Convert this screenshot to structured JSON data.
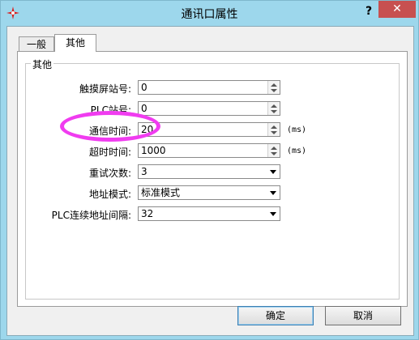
{
  "window": {
    "title": "通讯口属性",
    "help_label": "?",
    "close_label": "✕"
  },
  "tabs": [
    {
      "label": "一般",
      "active": false
    },
    {
      "label": "其他",
      "active": true
    }
  ],
  "group": {
    "title": "其他"
  },
  "fields": [
    {
      "label": "触摸屏站号:",
      "value": "0",
      "control": "spinner",
      "unit": ""
    },
    {
      "label": "PLC站号:",
      "value": "0",
      "control": "spinner",
      "unit": ""
    },
    {
      "label": "通信时间:",
      "value": "20",
      "control": "spinner",
      "unit": "(ms)"
    },
    {
      "label": "超时时间:",
      "value": "1000",
      "control": "spinner",
      "unit": "(ms)"
    },
    {
      "label": "重试次数:",
      "value": "3",
      "control": "dropdown",
      "unit": ""
    },
    {
      "label": "地址模式:",
      "value": "标准模式",
      "control": "dropdown",
      "unit": ""
    },
    {
      "label": "PLC连续地址间隔:",
      "value": "32",
      "control": "dropdown",
      "unit": ""
    }
  ],
  "buttons": {
    "ok": "确定",
    "cancel": "取消"
  },
  "colors": {
    "titlebar": "#9dd7ec",
    "close": "#c75050",
    "highlight": "#f03cf0"
  },
  "icons": {
    "app": "red-star-gear-icon"
  }
}
